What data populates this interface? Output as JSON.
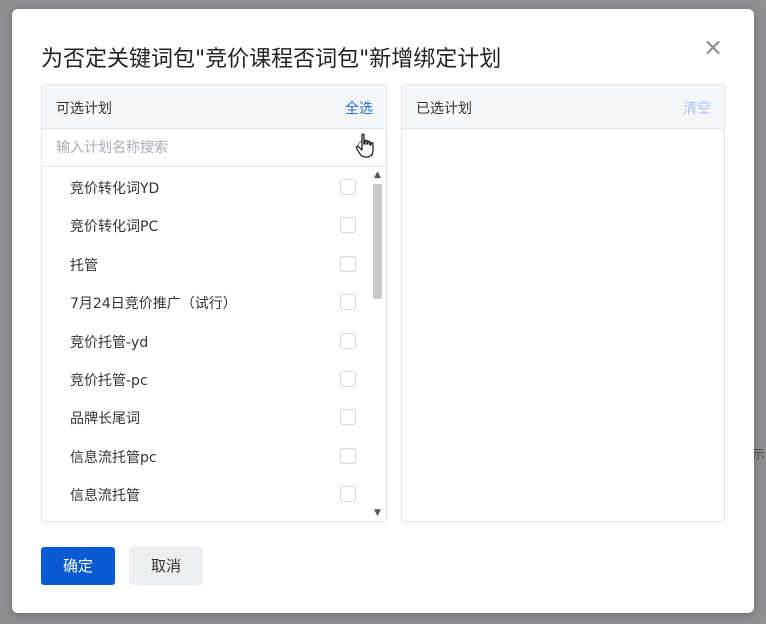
{
  "background": {
    "fragment": "示"
  },
  "dialog": {
    "title": "为否定关键词包\"竞价课程否词包\"新增绑定计划",
    "close_symbol": "×"
  },
  "available": {
    "title": "可选计划",
    "select_all": "全选",
    "search_placeholder": "输入计划名称搜索",
    "items": [
      {
        "label": "竞价转化词YD",
        "checked": false
      },
      {
        "label": "竞价转化词PC",
        "checked": false
      },
      {
        "label": "托管",
        "checked": false
      },
      {
        "label": "7月24日竞价推广（试行）",
        "checked": false
      },
      {
        "label": "竞价托管-yd",
        "checked": false
      },
      {
        "label": "竞价托管-pc",
        "checked": false
      },
      {
        "label": "品牌长尾词",
        "checked": false
      },
      {
        "label": "信息流托管pc",
        "checked": false
      },
      {
        "label": "信息流托管",
        "checked": false
      }
    ]
  },
  "selected": {
    "title": "已选计划",
    "clear": "清空"
  },
  "footer": {
    "confirm": "确定",
    "cancel": "取消"
  },
  "colors": {
    "primary": "#0a5bd3",
    "link": "#1f6fe5",
    "link_disabled": "#a5c3ef"
  }
}
